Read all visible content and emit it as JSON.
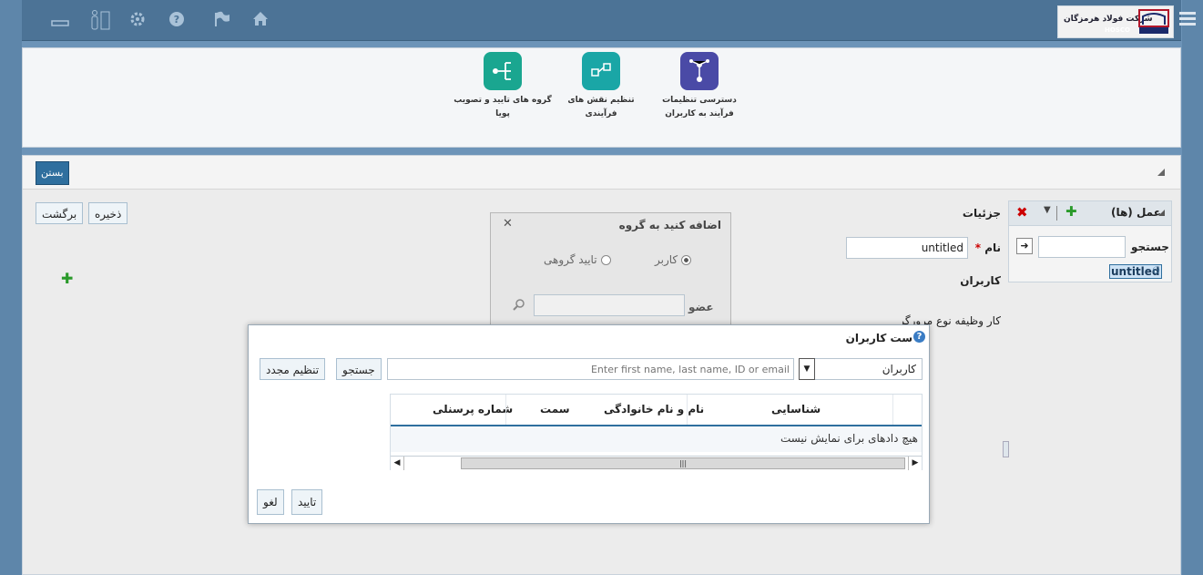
{
  "topbar": {
    "company_name": "شرکت فولاد هرمزگان",
    "logo_text": "HOSCO",
    "icons": [
      "home-icon",
      "flag-icon",
      "help-icon",
      "settings-gear-icon",
      "restroom-icon",
      "minimize-icon"
    ]
  },
  "ribbon": {
    "items": [
      {
        "label": "دسترسی تنظیمات فرآیند به کاربران"
      },
      {
        "label": "تنظیم نقش های فرآیندی"
      },
      {
        "label": "گروه های تایید و تصویب پویا"
      }
    ]
  },
  "panel": {
    "close_label": "بستن",
    "save_label": "ذخیره",
    "back_label": "برگشت",
    "details_title": "جزئیات",
    "name_label": "نام",
    "name_required": "*",
    "name_value": "untitled",
    "users_label": "کاربران",
    "browser_type_text": "کار وظیفه نوع مرورگر"
  },
  "actions_panel": {
    "title": "عمل (ها)",
    "search_label": "جستجو",
    "search_value": "",
    "tree_item": "untitled"
  },
  "add_to_group_dialog": {
    "title": "اضافه کنید به گروه",
    "option_user": "کاربر",
    "option_group_approval": "تایید گروهی",
    "selected": "کاربر",
    "member_label": "عضو",
    "member_value": ""
  },
  "users_dialog": {
    "title": "ست کاربران",
    "scope_select": "کاربران",
    "search_placeholder": "Enter first name, last name, ID or email",
    "search_button": "جستجو",
    "reset_button": "تنظیم مجدد",
    "columns": [
      "شناسایی",
      "نام و نام خانوادگی",
      "سمت",
      "شماره پرسنلی"
    ],
    "empty_text": "هیچ دادهای برای نمایش نیست",
    "ok_button": "تایید",
    "cancel_button": "لغو"
  },
  "colors": {
    "frame": "#6d94b8",
    "topbar": "#4c7396",
    "primary_button": "#2f6f9e",
    "ribbon_purple": "#4a4aa6",
    "ribbon_teal": "#1aa6a6"
  }
}
